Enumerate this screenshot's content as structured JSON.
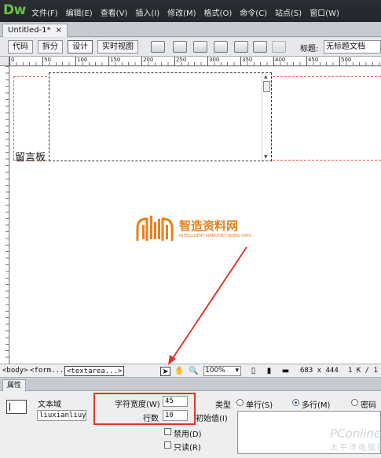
{
  "app": {
    "logo": "Dw"
  },
  "menu": [
    "文件(F)",
    "编辑(E)",
    "查看(V)",
    "插入(I)",
    "修改(M)",
    "格式(O)",
    "命令(C)",
    "站点(S)",
    "窗口(W)"
  ],
  "document": {
    "tab_title": "Untitled-1*",
    "close_glyph": "×"
  },
  "toolbar": {
    "view_buttons": [
      "代码",
      "拆分",
      "设计",
      "实时视图"
    ],
    "active_view": "设计",
    "title_label": "标题:",
    "title_value": "无标题文档"
  },
  "ruler": {
    "ticks": [
      "0",
      "50",
      "100",
      "150",
      "200",
      "250",
      "300",
      "350",
      "400",
      "450",
      "500"
    ]
  },
  "canvas": {
    "label_text": "留言板"
  },
  "watermark": {
    "name": "智造资料网",
    "sub": "INTELLIGENT MANUFACTURING DATA"
  },
  "statusbar": {
    "tags": [
      "<body>",
      "<form...>",
      "<textarea...>"
    ],
    "selected_tag": "<textarea...>",
    "zoom": "100%",
    "dimensions": "683 x 444",
    "size_info": "1 K / 1"
  },
  "properties": {
    "tab_label": "属性",
    "field_label": "文本域",
    "field_name": "liuxianliuyan",
    "char_width_label": "字符宽度(W)",
    "char_width": "45",
    "rows_label": "行数",
    "rows": "10",
    "type_label": "类型",
    "type_options": [
      "单行(S)",
      "多行(M)",
      "密码"
    ],
    "type_selected": "多行(M)",
    "initial_label": "初始值(I)",
    "disabled_label": "禁用(D)",
    "readonly_label": "只读(R)"
  },
  "site_watermark": {
    "main": "PConline",
    "sub": "太平洋电脑网"
  },
  "colors": {
    "accent_logo": "#6ac04a",
    "highlight": "#e0362a",
    "form_outline": "#e05a46"
  }
}
